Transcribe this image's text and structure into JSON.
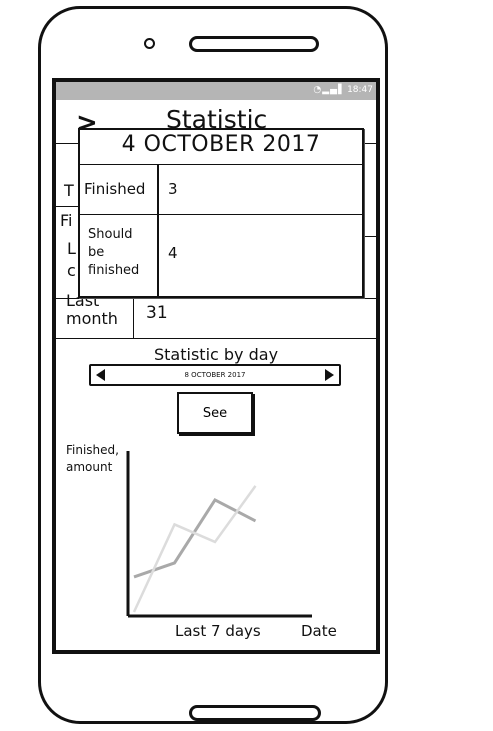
{
  "status_bar": {
    "icons": "wifi-icon signal-icon battery-icon",
    "time": "18:47"
  },
  "header": {
    "back_icon": "chevron-right-icon",
    "title": "Statistic"
  },
  "hidden_fragments": {
    "t": "T",
    "fi": "Fi",
    "l": "L",
    "c": "c"
  },
  "last_month": {
    "label": "Last month",
    "value": "31"
  },
  "day_stats": {
    "heading": "Statistic by day",
    "selected_date": "8 OCTOBER 2017",
    "see_label": "See"
  },
  "popup": {
    "date": "4 OCTOBER 2017",
    "finished_label": "Finished",
    "finished_value": "3",
    "should_label": "Should be finished",
    "should_value": "4"
  },
  "chart_data": {
    "type": "line",
    "ylabel": "Finished, amount",
    "xlabel": "Last 7 days",
    "xunit": "Date",
    "x": [
      1,
      2,
      3,
      4,
      5
    ],
    "series": [
      {
        "values": [
          1.0,
          1.4,
          3.2,
          2.6,
          null
        ],
        "color": "#a9a9a9"
      },
      {
        "values": [
          0.0,
          2.5,
          2.0,
          3.6,
          null
        ],
        "color": "#dcdcdc"
      }
    ],
    "axis_color": "#111111"
  }
}
